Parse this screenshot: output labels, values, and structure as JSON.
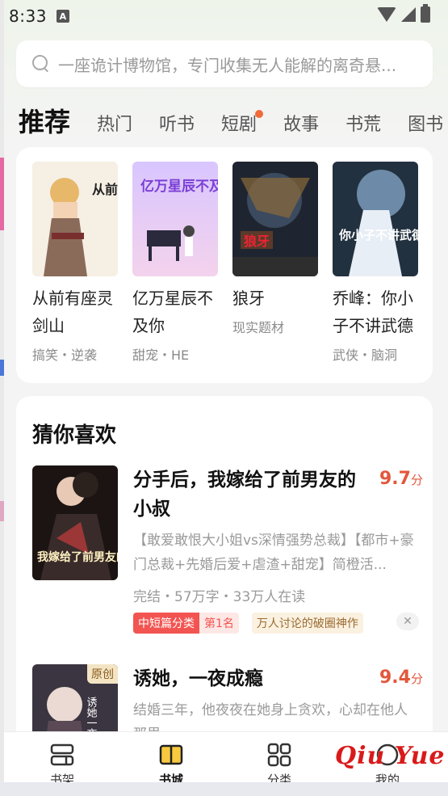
{
  "status": {
    "time": "8:33",
    "notification_letter": "A"
  },
  "search": {
    "placeholder": "一座诡计博物馆，专门收集无人能解的离奇悬..."
  },
  "tabs": [
    {
      "label": "推荐",
      "active": true
    },
    {
      "label": "热门"
    },
    {
      "label": "听书"
    },
    {
      "label": "短剧",
      "dot": true
    },
    {
      "label": "故事"
    },
    {
      "label": "书荒"
    },
    {
      "label": "图书"
    }
  ],
  "recommend": {
    "books": [
      {
        "title": "从前有座灵剑山",
        "tags": "搞笑・逆袭",
        "cover_text": "从前有座灵剑山"
      },
      {
        "title": "亿万星辰不及你",
        "tags": "甜宠・HE",
        "cover_text": "亿万星辰不及你"
      },
      {
        "title": "狼牙",
        "tags": "现实题材",
        "cover_text": "狼牙"
      },
      {
        "title": "乔峰：你小子不讲武德",
        "tags": "武侠・脑洞",
        "cover_text": "你小子不讲武德"
      }
    ]
  },
  "guess": {
    "title": "猜你喜欢",
    "items": [
      {
        "title": "分手后，我嫁给了前男友的小叔",
        "score": "9.7",
        "score_unit": "分",
        "desc": "【敢爱敢恨大小姐vs深情强势总裁】【都市+豪门总裁+先婚后爱+虐渣+甜宠】简橙活...",
        "meta": "完结・57万字・33万人在读",
        "tag_category": "中短篇分类",
        "tag_rank": "第1名",
        "tag_hot": "万人讨论的破圈神作",
        "close": "✕",
        "cover_text": "我嫁给了前男友的小叔"
      },
      {
        "title": "诱她，一夜成瘾",
        "score": "9.4",
        "score_unit": "分",
        "desc": "结婚三年，他夜夜在她身上贪欢，心却在他人那里...",
        "badge": "原创",
        "cover_text": "诱她一夜成瘾"
      }
    ]
  },
  "nav": [
    {
      "label": "书架",
      "icon": "bookshelf-icon"
    },
    {
      "label": "书城",
      "icon": "bookstore-icon",
      "active": true
    },
    {
      "label": "分类",
      "icon": "category-grid-icon"
    },
    {
      "label": "我的",
      "icon": "profile-icon"
    }
  ],
  "watermark": {
    "text": "Qiu Yue"
  },
  "colors": {
    "accent_red": "#e2583b",
    "tab_highlight": "#f6d84b",
    "dot": "#f06a3a"
  }
}
